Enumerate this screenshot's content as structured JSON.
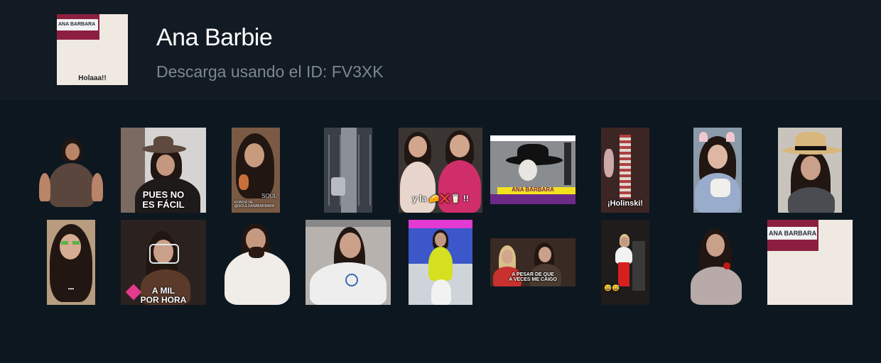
{
  "header": {
    "title": "Ana Barbie",
    "subtitle": "Descarga usando el ID: FV3XK",
    "thumb_sign": "ANA BARBARA",
    "thumb_caption": "Holaaa!!"
  },
  "stickers": {
    "s2": "PUES NO\nES FÁCIL",
    "s3": "RUBOR DE\n@SOULXANABARBARA",
    "s3b": "SOUL",
    "s5": "y la 🧀❌🥛 !!",
    "s6": "ANA BÁRBARA",
    "s7": "¡Holinski!",
    "s10": "•••",
    "s11": "A MIL\nPOR HORA",
    "s15": "A PESAR DE QUE\nA VECES ME CAIGO",
    "s16": "😅😅",
    "s18": "ANA BARBARA"
  },
  "colors": {
    "background": "#0d1720",
    "header": "#121b23",
    "accent": "#8c1f3f"
  }
}
